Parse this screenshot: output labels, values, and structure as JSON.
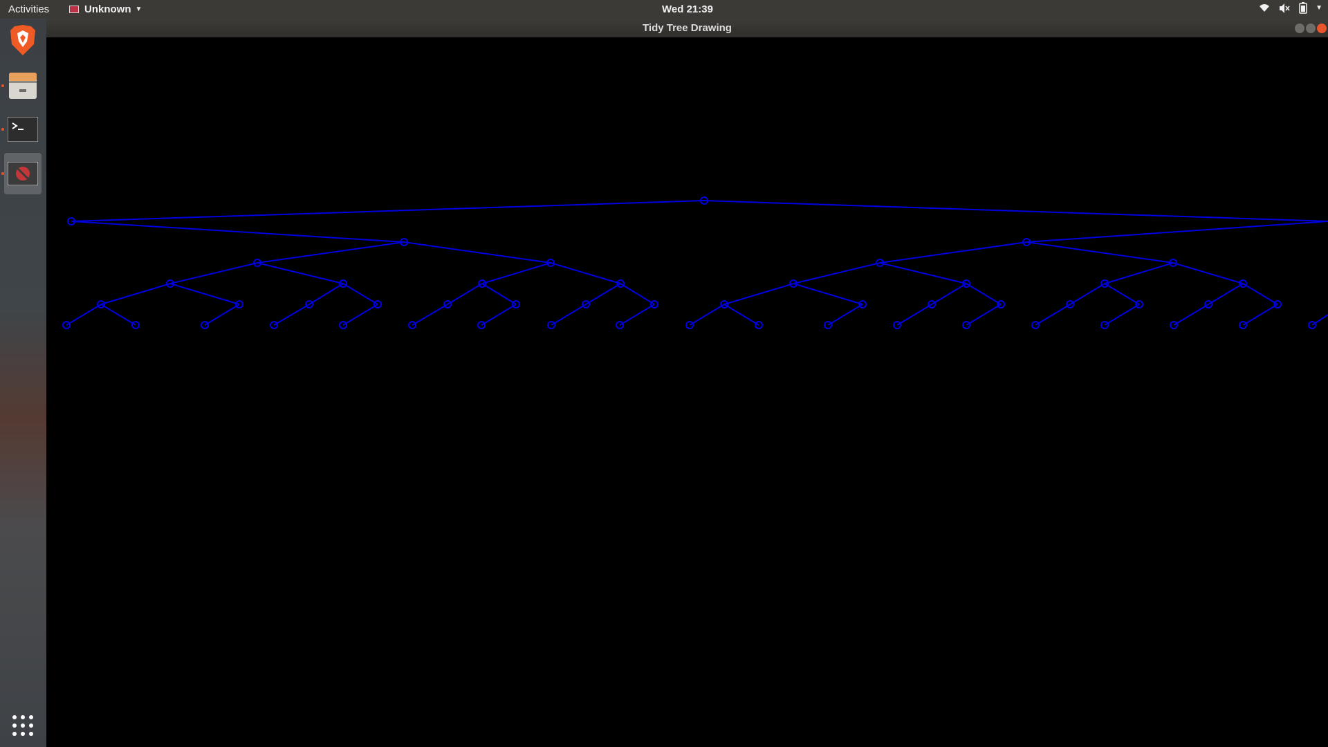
{
  "topbar": {
    "activities": "Activities",
    "app_menu": "Unknown",
    "clock": "Wed 21:39"
  },
  "dock": {
    "items": [
      {
        "name": "Brave Browser",
        "icon": "brave-icon"
      },
      {
        "name": "Files",
        "icon": "files-icon"
      },
      {
        "name": "Terminal",
        "icon": "terminal-icon"
      },
      {
        "name": "Tidy Tree Drawing",
        "icon": "app-icon",
        "active": true
      }
    ],
    "show_apps_icon": "grid-icon"
  },
  "window": {
    "title": "Tidy Tree Drawing"
  },
  "colors": {
    "tree": "#0000e0",
    "canvas_bg": "#000000",
    "topbar_bg": "#3b3a37",
    "close_btn": "#e9542b"
  }
}
